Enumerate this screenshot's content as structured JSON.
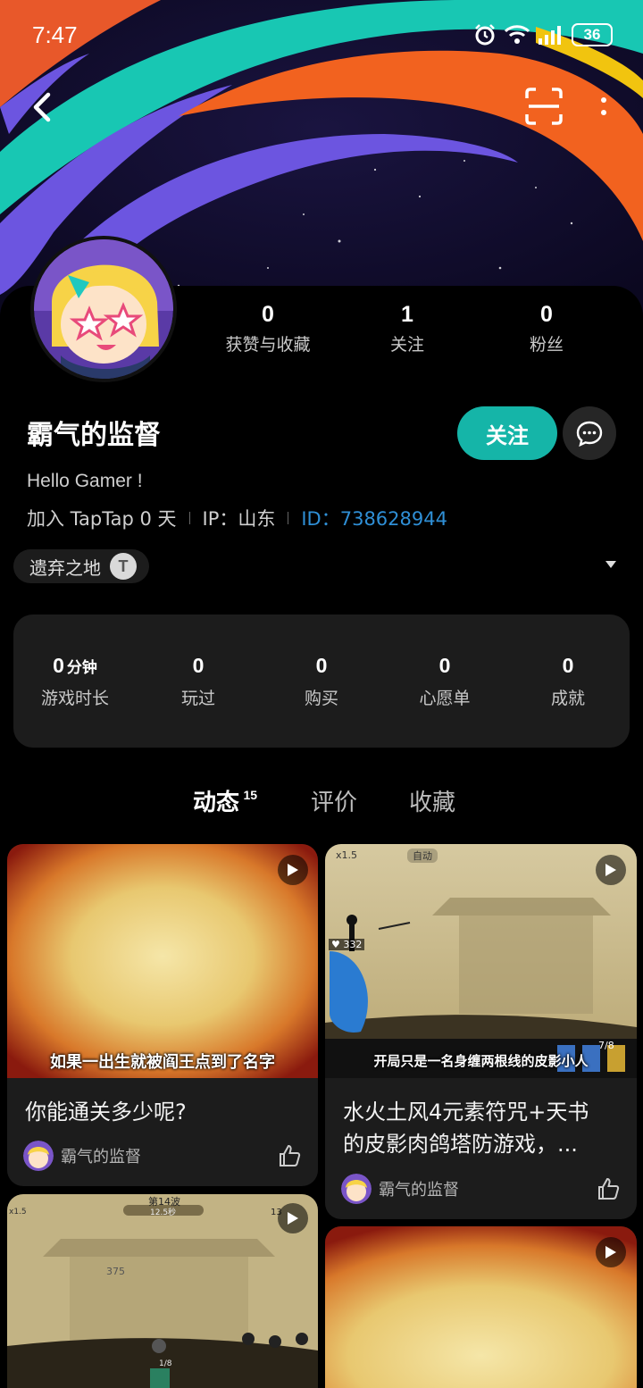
{
  "status_bar": {
    "time": "7:47",
    "battery": "36"
  },
  "profile": {
    "username": "霸气的监督",
    "bio": "Hello Gamer !",
    "joined": "加入 TapTap 0 天",
    "ip": "IP：山东",
    "id": "ID：738628944",
    "follow_label": "关注",
    "stats": [
      {
        "value": "0",
        "label": "获赞与收藏"
      },
      {
        "value": "1",
        "label": "关注"
      },
      {
        "value": "0",
        "label": "粉丝"
      }
    ],
    "badge": "遗弃之地",
    "badge_icon_letter": "T"
  },
  "game_stats": [
    {
      "value": "0",
      "unit": "分钟",
      "label": "游戏时长"
    },
    {
      "value": "0",
      "unit": "",
      "label": "玩过"
    },
    {
      "value": "0",
      "unit": "",
      "label": "购买"
    },
    {
      "value": "0",
      "unit": "",
      "label": "心愿单"
    },
    {
      "value": "0",
      "unit": "",
      "label": "成就"
    }
  ],
  "tabs": [
    {
      "label": "动态",
      "count": "15",
      "active": true
    },
    {
      "label": "评价",
      "count": "",
      "active": false
    },
    {
      "label": "收藏",
      "count": "",
      "active": false
    }
  ],
  "feed": [
    {
      "caption": "如果一出生就被阎王点到了名字",
      "title": "你能通关多少呢?",
      "author": "霸气的监督"
    },
    {
      "caption": "开局只是一名身缠两根线的皮影小人",
      "title_line1": "水火土风4元素符咒+天书",
      "title_line2": "的皮影肉鸽塔防游戏，...",
      "author": "霸气的监督",
      "hud": {
        "heart": "332",
        "speed": "x1.5",
        "wave": "7/8",
        "auto": "自动"
      }
    },
    {
      "hud": {
        "wave_label": "第14波",
        "timer": "12.5秒",
        "score": "375",
        "page": "1/8",
        "kills": "13",
        "speed": "x1.5"
      }
    },
    {}
  ],
  "colors": {
    "accent": "#15b5a8",
    "id_link": "#2f8fd6",
    "panel": "#1c1c1c"
  }
}
